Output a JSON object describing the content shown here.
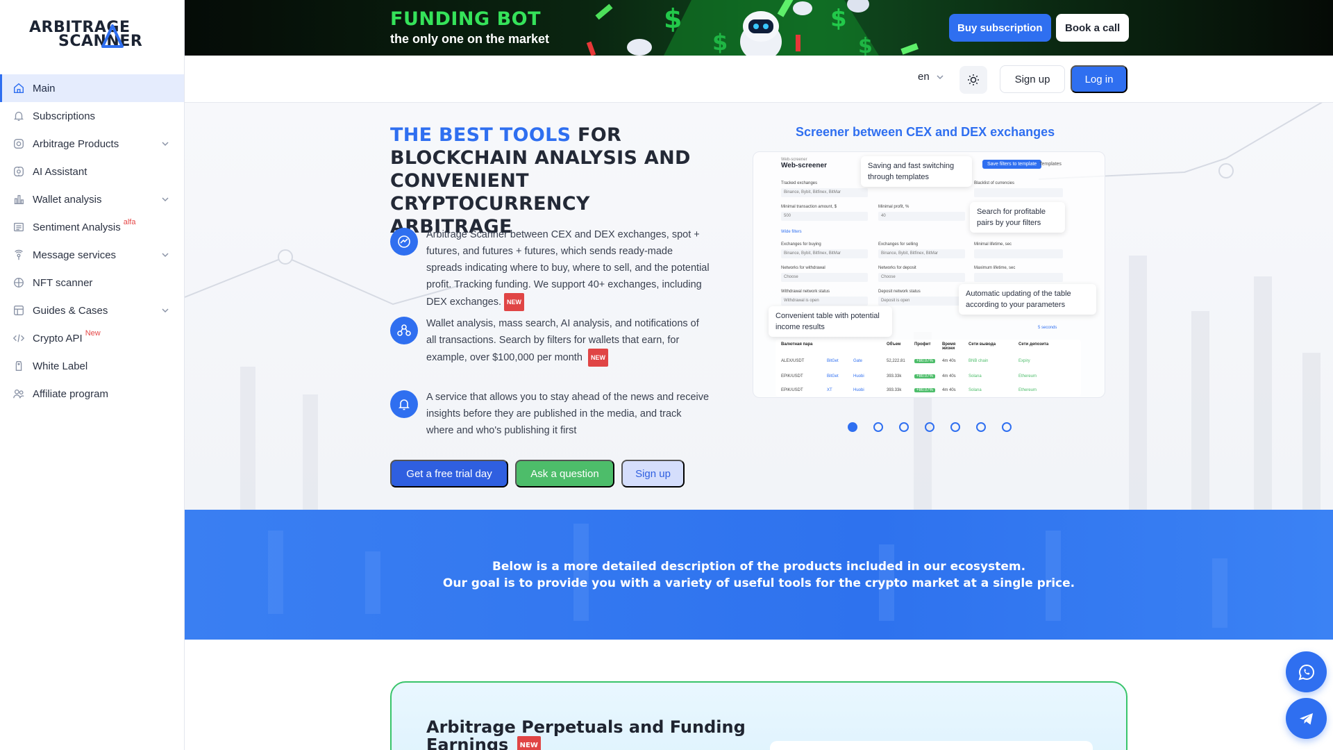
{
  "brand": {
    "line1": "ARBITRAGE",
    "line2": "SCANNER"
  },
  "sidebar": {
    "items": [
      {
        "label": "Main",
        "icon": "home-icon",
        "active": true,
        "chevron": false,
        "sup": ""
      },
      {
        "label": "Subscriptions",
        "icon": "bell-icon",
        "active": false,
        "chevron": false,
        "sup": ""
      },
      {
        "label": "Arbitrage Products",
        "icon": "scan-icon",
        "active": false,
        "chevron": true,
        "sup": ""
      },
      {
        "label": "AI Assistant",
        "icon": "ai-icon",
        "active": false,
        "chevron": false,
        "sup": ""
      },
      {
        "label": "Wallet analysis",
        "icon": "bar-chart-icon",
        "active": false,
        "chevron": true,
        "sup": ""
      },
      {
        "label": "Sentiment Analysis",
        "icon": "news-icon",
        "active": false,
        "chevron": false,
        "sup": "alfa"
      },
      {
        "label": "Message services",
        "icon": "signal-icon",
        "active": false,
        "chevron": true,
        "sup": ""
      },
      {
        "label": "NFT scanner",
        "icon": "nft-icon",
        "active": false,
        "chevron": false,
        "sup": ""
      },
      {
        "label": "Guides & Cases",
        "icon": "guide-icon",
        "active": false,
        "chevron": true,
        "sup": ""
      },
      {
        "label": "Crypto API",
        "icon": "code-icon",
        "active": false,
        "chevron": false,
        "sup": "New"
      },
      {
        "label": "White Label",
        "icon": "label-icon",
        "active": false,
        "chevron": false,
        "sup": ""
      },
      {
        "label": "Affiliate program",
        "icon": "users-icon",
        "active": false,
        "chevron": false,
        "sup": ""
      }
    ]
  },
  "banner": {
    "title": "FUNDING BOT",
    "subtitle": "the only one on the market",
    "buy_label": "Buy subscription",
    "call_label": "Book a call"
  },
  "header": {
    "language": "en",
    "signup_label": "Sign up",
    "login_label": "Log in"
  },
  "hero": {
    "title_highlight": "THE BEST TOOLS",
    "title_rest": " FOR BLOCKCHAIN ANALYSIS AND CONVENIENT CRYPTOCURRENCY ARBITRAGE",
    "features": [
      {
        "text": "Arbitrage Scanner between CEX and DEX exchanges, spot + futures, and futures + futures, which sends ready-made spreads indicating where to buy, where to sell, and the potential profit. Tracking funding. We support 40+ exchanges, including DEX exchanges.",
        "badge": "NEW"
      },
      {
        "text": "Wallet analysis, mass search, AI analysis, and notifications of all transactions. Search by filters for wallets that earn, for example, over $100,000 per month",
        "badge": "NEW"
      },
      {
        "text": "A service that allows you to stay ahead of the news and receive insights before they are published in the media, and track where and who's publishing it first",
        "badge": ""
      }
    ],
    "buttons": {
      "trial": "Get a free trial day",
      "ask": "Ask a question",
      "signup": "Sign up"
    }
  },
  "carousel": {
    "title": "Screener between CEX and DEX exchanges",
    "slide_count": 7,
    "active_slide": 1,
    "mock": {
      "header_small": "Web-screener",
      "header": "Web-screener",
      "save_button": "Save filters to template",
      "templates": "Templates",
      "labels": [
        "Tracked exchanges",
        "Blacklist of currencies",
        "Minimal transaction amount, $",
        "Minimal profit, %",
        "Wide filters",
        "Exchanges for buying",
        "Exchanges for selling",
        "Minimal lifetime, sec",
        "Networks for withdrawal",
        "Networks for deposit",
        "Maximum lifetime, sec",
        "Withdrawal network status",
        "Deposit network status"
      ],
      "fields": [
        "Binance, Bybit, Bitfinex, BitMar",
        "500",
        "40",
        "Binance, Bybit, Bitfinex, BitMar",
        "Binance, Bybit, Bitfinex, BitMar",
        "Choose",
        "Choose",
        "Withdrawal is open",
        "Deposit is open"
      ],
      "interval": "5 seconds",
      "table_headers": [
        "Валютная пара",
        "Объем",
        "Профит",
        "Время жизни",
        "Сети вывода",
        "Сети депозита"
      ],
      "table_rows": [
        [
          "ALEX/USDT",
          "BitGet",
          "Gate",
          "52,222.81",
          "+80.07%",
          "4m 40s",
          "BNB chain",
          "Expiry"
        ],
        [
          "EPIK/USDT",
          "BitGet",
          "Huobi",
          "393.33k",
          "+80.07%",
          "4m 40s",
          "Solana",
          "Ethereum"
        ],
        [
          "EPIK/USDT",
          "XT",
          "Huobi",
          "393.33k",
          "+80.07%",
          "4m 40s",
          "Solana",
          "Ethereum"
        ]
      ],
      "callouts": [
        "Saving and fast switching through templates",
        "Search for profitable pairs by your filters",
        "Automatic updating of the table according to your parameters",
        "Convenient table with potential income results"
      ]
    }
  },
  "band": {
    "line1": "Below is a more detailed description of the products included in our ecosystem.",
    "line2": "Our goal is to provide you with a variety of useful tools for the crypto market at a single price."
  },
  "product": {
    "title": "Arbitrage Perpetuals and Funding Earnings",
    "badge": "NEW"
  },
  "fabs": [
    {
      "icon": "whatsapp-icon"
    },
    {
      "icon": "telegram-icon"
    }
  ],
  "colors": {
    "accent": "#2f6ff0",
    "banner_green": "#35e35a",
    "success": "#4dbd6a",
    "badge_red": "#e04545"
  }
}
